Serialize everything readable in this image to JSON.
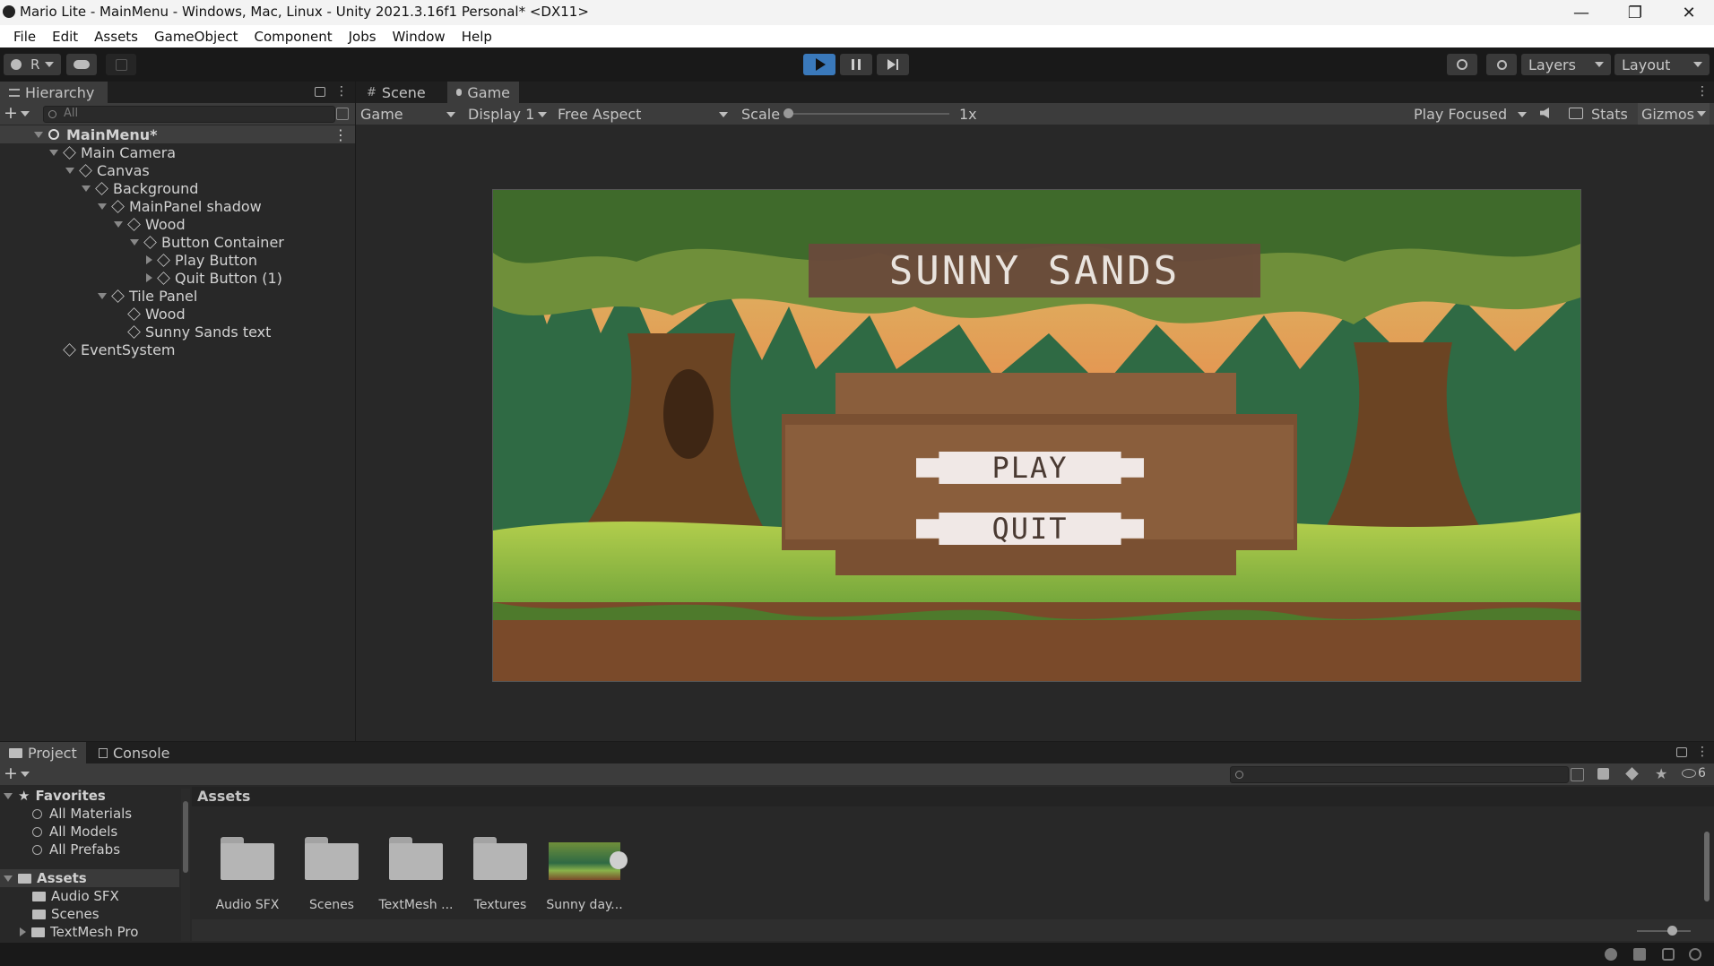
{
  "window": {
    "title": "Mario Lite - MainMenu - Windows, Mac, Linux - Unity 2021.3.16f1 Personal* <DX11>"
  },
  "menubar": [
    "File",
    "Edit",
    "Assets",
    "GameObject",
    "Component",
    "Jobs",
    "Window",
    "Help"
  ],
  "toolbar": {
    "account": "R",
    "layers": "Layers",
    "layout": "Layout"
  },
  "hierarchy": {
    "tab": "Hierarchy",
    "search_placeholder": "All",
    "items": [
      {
        "label": "MainMenu*"
      },
      {
        "label": "Main Camera"
      },
      {
        "label": "Canvas"
      },
      {
        "label": "Background"
      },
      {
        "label": "MainPanel shadow"
      },
      {
        "label": "Wood"
      },
      {
        "label": "Button Container"
      },
      {
        "label": "Play Button"
      },
      {
        "label": "Quit Button (1)"
      },
      {
        "label": "Tile Panel"
      },
      {
        "label": "Wood"
      },
      {
        "label": "Sunny Sands text"
      },
      {
        "label": "EventSystem"
      }
    ]
  },
  "viewtabs": {
    "scene": "Scene",
    "game": "Game"
  },
  "gamebar": {
    "mode": "Game",
    "display": "Display 1",
    "aspect": "Free Aspect",
    "scale_label": "Scale",
    "scale_value": "1x",
    "scale_level": 0.0,
    "play_focused": "Play Focused",
    "stats": "Stats",
    "gizmos": "Gizmos"
  },
  "game": {
    "title": "SUNNY SANDS",
    "play": "PLAY",
    "quit": "QUIT"
  },
  "project": {
    "tab_project": "Project",
    "tab_console": "Console",
    "hidden_count": "6",
    "favorites_label": "Favorites",
    "favorites": [
      "All Materials",
      "All Models",
      "All Prefabs"
    ],
    "assets_label": "Assets",
    "asset_folders": [
      "Audio SFX",
      "Scenes",
      "TextMesh Pro"
    ],
    "breadcrumb": "Assets",
    "items": [
      "Audio SFX",
      "Scenes",
      "TextMesh ...",
      "Textures",
      "Sunny day..."
    ]
  },
  "colors": {
    "accent": "#3a79bb",
    "panel": "#282828",
    "header": "#3c3c3c"
  }
}
